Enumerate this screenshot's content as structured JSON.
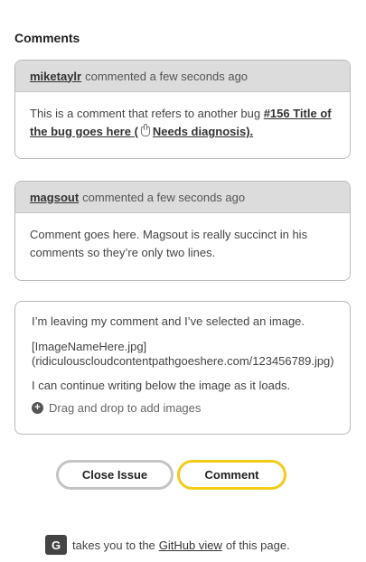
{
  "comments_section": {
    "title": "Comments"
  },
  "comments": [
    {
      "author": "miketaylr",
      "meta": "commented a few seconds ago",
      "body_prefix": "This is a comment that refers to another bug ",
      "ref_link_start": "#156 Title of the bug goes here (",
      "ref_link_icon": "hand-icon",
      "ref_link_end": "Needs diagnosis)."
    },
    {
      "author": "magsout",
      "meta": "commented a few seconds ago",
      "body": "Comment goes here. Magsout is really succinct in his comments so they’re only two lines."
    }
  ],
  "editor": {
    "line1": "I’m leaving my comment and I’ve selected an image.",
    "line2": "[ImageNameHere.jpg]",
    "line3": "(ridiculouscloudcontentpathgoeshere.com/123456789.jpg)",
    "line4": "I can continue writing below the image as it loads.",
    "drop_hint": "Drag and drop to add images",
    "drop_icon": "plus-circle-icon"
  },
  "actions": {
    "close_label": "Close Issue",
    "comment_label": "Comment",
    "comment_accent": "#f2cc19"
  },
  "footer": {
    "key": "G",
    "text_before": "takes you to the",
    "link": "GitHub view",
    "text_after": "of this page."
  }
}
